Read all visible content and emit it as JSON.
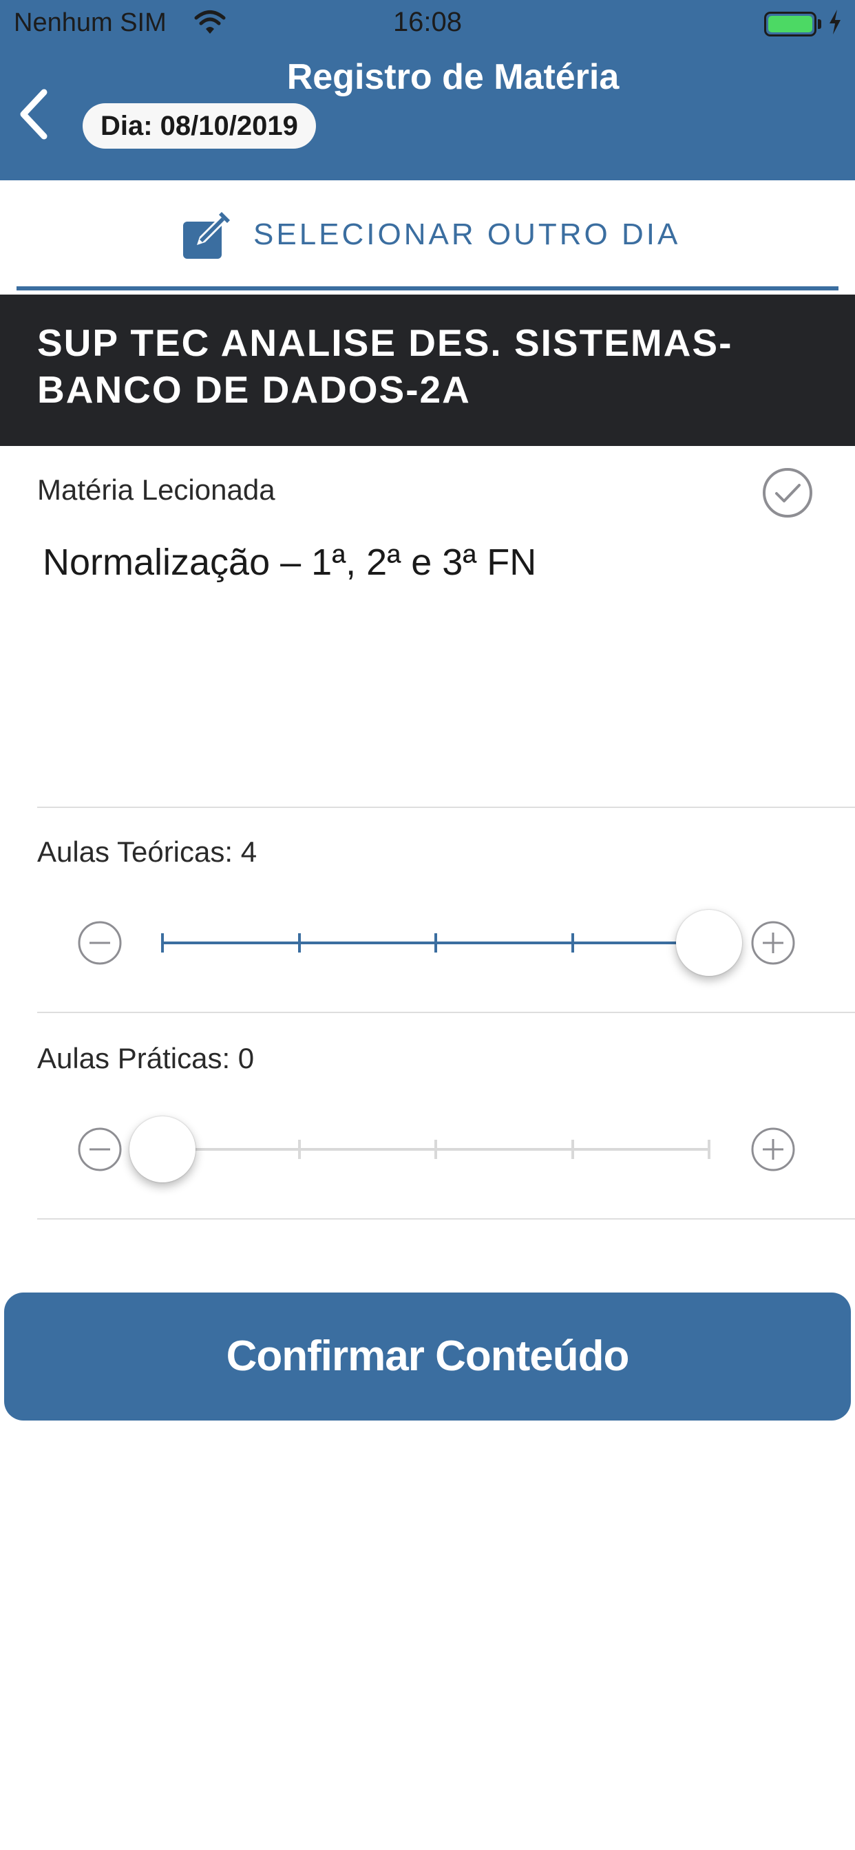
{
  "status_bar": {
    "carrier": "Nenhum SIM",
    "time": "16:08"
  },
  "nav": {
    "title": "Registro de Matéria",
    "date_pill": "Dia: 08/10/2019"
  },
  "select_day": {
    "label": "SELECIONAR OUTRO DIA"
  },
  "course": {
    "title": "SUP TEC ANALISE DES. SISTEMAS-BANCO DE DADOS-2A"
  },
  "materia": {
    "label": "Matéria Lecionada",
    "value": "Normalização – 1ª, 2ª e 3ª FN"
  },
  "aulas_teoricas": {
    "label": "Aulas Teóricas: 4",
    "value": 4,
    "max": 4
  },
  "aulas_praticas": {
    "label": "Aulas Práticas: 0",
    "value": 0,
    "max": 4
  },
  "confirm_button": {
    "label": "Confirmar Conteúdo"
  },
  "colors": {
    "brand": "#3b6ea0",
    "band": "#242528",
    "inactive_track": "#d9d9d9",
    "battery": "#4cd964"
  },
  "icons": [
    "wifi-icon",
    "battery-icon",
    "charging-bolt-icon",
    "back-chevron-icon",
    "edit-icon",
    "check-circle-icon",
    "minus-circle-icon",
    "plus-circle-icon"
  ]
}
